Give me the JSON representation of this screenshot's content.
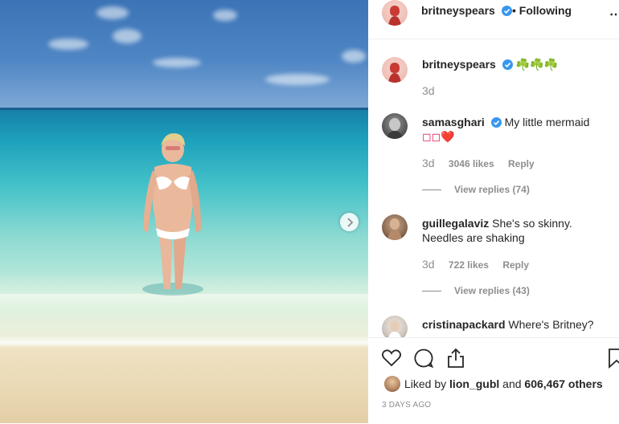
{
  "post": {
    "author": "britneyspears",
    "following_label": "• Following",
    "caption_author": "britneyspears",
    "caption_text": "☘️☘️☘️",
    "caption_time": "3d"
  },
  "comments": [
    {
      "username": "samasghari",
      "verified": true,
      "text_line1": "My little mermaid",
      "text_line2": "◻◻❤️",
      "time": "3d",
      "likes": "3046 likes",
      "reply": "Reply",
      "view_replies": "View replies (74)"
    },
    {
      "username": "guillegalaviz",
      "verified": false,
      "text_line1": "She's so skinny.",
      "text_line2": "Needles are shaking",
      "time": "3d",
      "likes": "722 likes",
      "reply": "Reply",
      "view_replies": "View replies (43)"
    },
    {
      "username": "cristinapackard",
      "verified": false,
      "text_line1": "Where's Britney?",
      "text_line2": "",
      "time": "",
      "likes": "",
      "reply": "",
      "view_replies": ""
    }
  ],
  "likes_summary": {
    "prefix": "Liked by ",
    "user": "lion_gubl",
    "middle": " and ",
    "count": "606,467 others"
  },
  "time_ago": "3 DAYS AGO",
  "icons": [
    "heart-icon",
    "comment-icon",
    "share-icon",
    "bookmark-icon",
    "verified-icon",
    "chevron-right-icon",
    "more-icon"
  ],
  "colors": {
    "verified": "#3897f0",
    "text": "#262626",
    "muted": "#8e8e8e",
    "border": "#efefef"
  }
}
